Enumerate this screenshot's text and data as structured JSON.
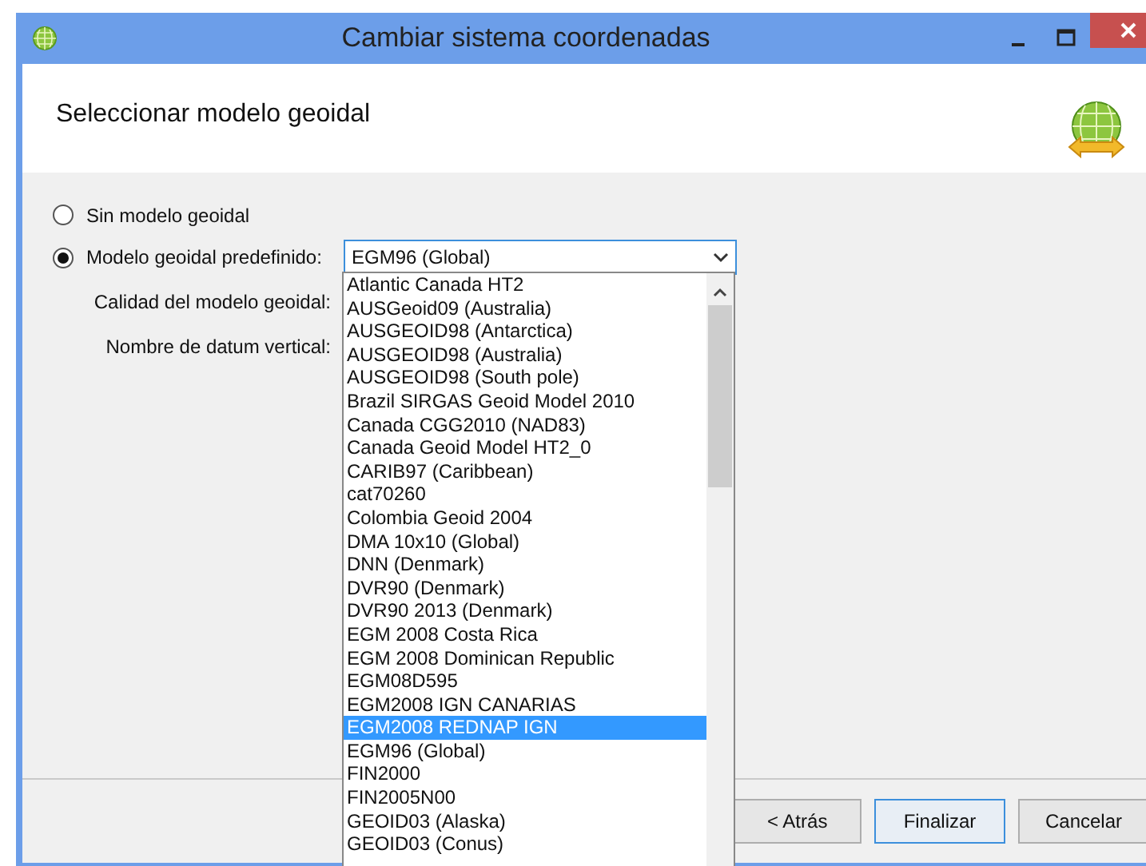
{
  "window": {
    "title": "Cambiar sistema coordenadas"
  },
  "header": {
    "title": "Seleccionar modelo geoidal"
  },
  "options": [
    {
      "label": "Sin modelo geoidal",
      "selected": false
    },
    {
      "label": "Modelo geoidal predefinido:",
      "selected": true
    }
  ],
  "combo": {
    "value": "EGM96 (Global)",
    "expanded": true
  },
  "fields": [
    {
      "label": "Calidad del modelo geoidal:"
    },
    {
      "label": "Nombre de datum vertical:"
    }
  ],
  "dropdown": {
    "items": [
      {
        "label": "Atlantic Canada HT2",
        "selected": false
      },
      {
        "label": "AUSGeoid09 (Australia)",
        "selected": false
      },
      {
        "label": "AUSGEOID98 (Antarctica)",
        "selected": false
      },
      {
        "label": "AUSGEOID98 (Australia)",
        "selected": false
      },
      {
        "label": "AUSGEOID98 (South pole)",
        "selected": false
      },
      {
        "label": "Brazil SIRGAS Geoid Model 2010",
        "selected": false
      },
      {
        "label": "Canada CGG2010 (NAD83)",
        "selected": false
      },
      {
        "label": "Canada Geoid Model HT2_0",
        "selected": false
      },
      {
        "label": "CARIB97 (Caribbean)",
        "selected": false
      },
      {
        "label": "cat70260",
        "selected": false
      },
      {
        "label": "Colombia Geoid 2004",
        "selected": false
      },
      {
        "label": "DMA 10x10 (Global)",
        "selected": false
      },
      {
        "label": "DNN (Denmark)",
        "selected": false
      },
      {
        "label": "DVR90 (Denmark)",
        "selected": false
      },
      {
        "label": "DVR90 2013 (Denmark)",
        "selected": false
      },
      {
        "label": "EGM 2008 Costa Rica",
        "selected": false
      },
      {
        "label": "EGM 2008 Dominican Republic",
        "selected": false
      },
      {
        "label": "EGM08D595",
        "selected": false
      },
      {
        "label": "EGM2008 IGN CANARIAS",
        "selected": false
      },
      {
        "label": "EGM2008 REDNAP IGN",
        "selected": true
      },
      {
        "label": "EGM96 (Global)",
        "selected": false
      },
      {
        "label": "FIN2000",
        "selected": false
      },
      {
        "label": "FIN2005N00",
        "selected": false
      },
      {
        "label": "GEOID03 (Alaska)",
        "selected": false
      },
      {
        "label": "GEOID03 (Conus)",
        "selected": false
      }
    ]
  },
  "buttons": [
    {
      "label": "< Atrás",
      "default": false
    },
    {
      "label": "Finalizar",
      "default": true
    },
    {
      "label": "Cancelar",
      "default": false
    }
  ]
}
